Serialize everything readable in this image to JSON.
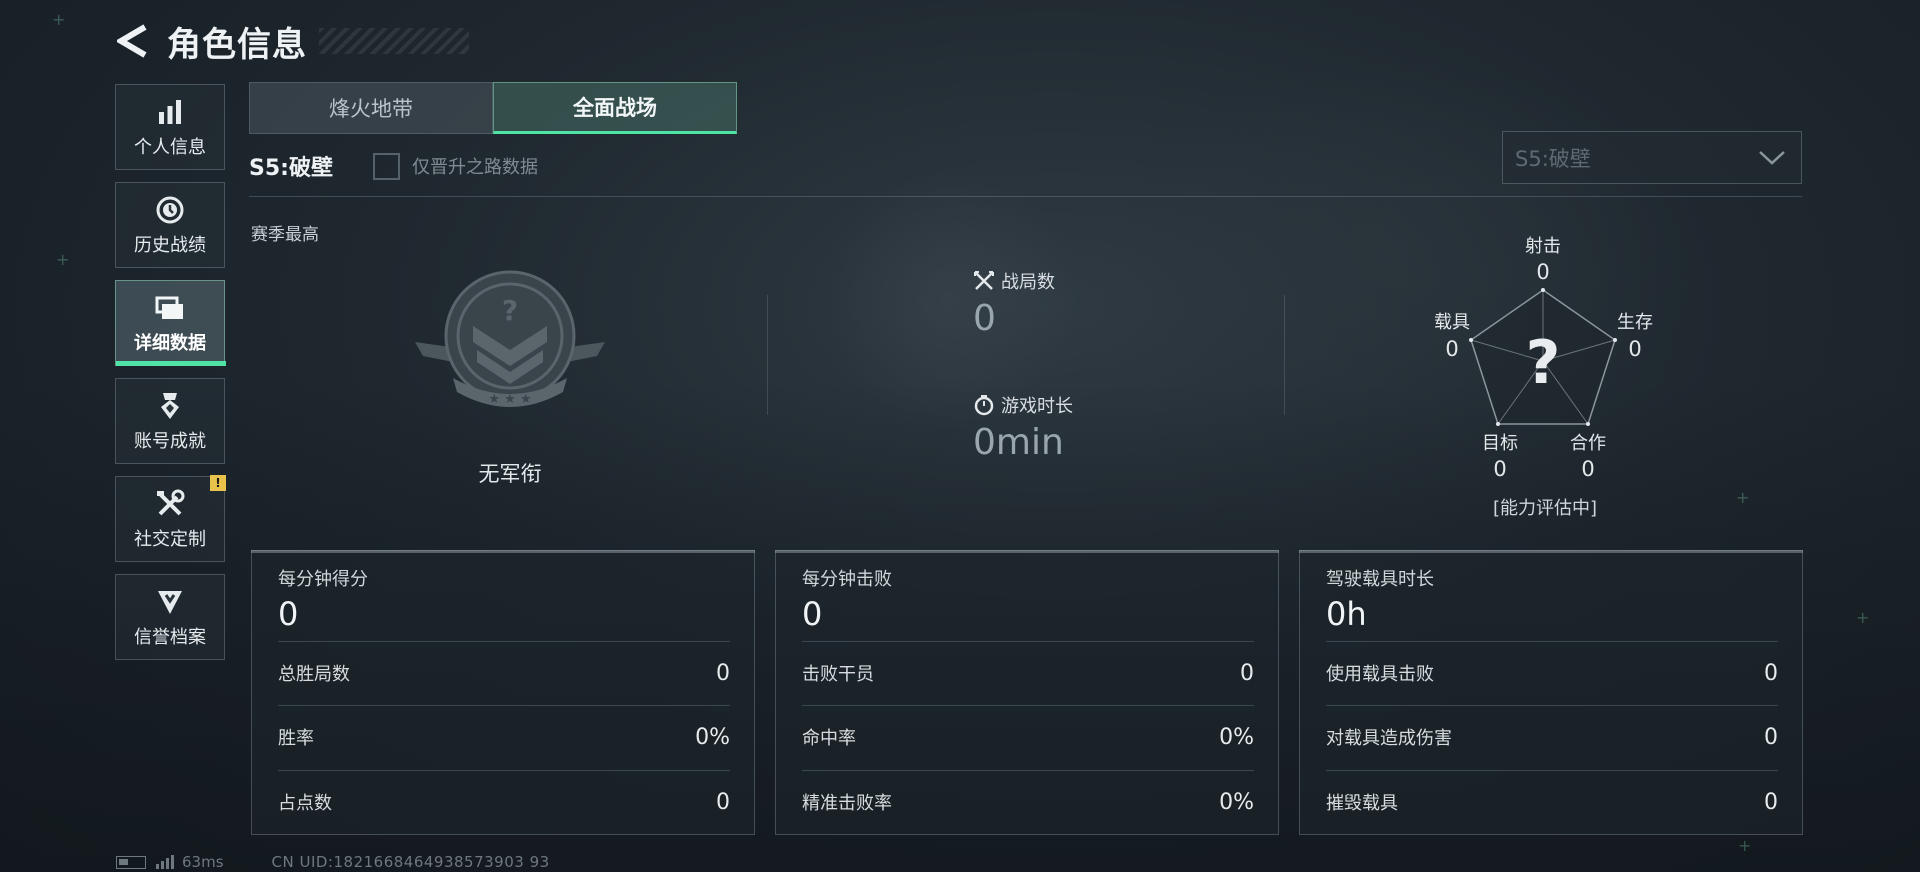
{
  "header": {
    "title": "角色信息"
  },
  "sidebar": {
    "items": [
      {
        "label": "个人信息",
        "icon": "bar-chart-icon",
        "active": false
      },
      {
        "label": "历史战绩",
        "icon": "history-icon",
        "active": false
      },
      {
        "label": "详细数据",
        "icon": "folder-icon",
        "active": true
      },
      {
        "label": "账号成就",
        "icon": "medal-icon",
        "active": false
      },
      {
        "label": "社交定制",
        "icon": "tools-icon",
        "active": false,
        "badge": "!"
      },
      {
        "label": "信誉档案",
        "icon": "shield-icon",
        "active": false
      }
    ]
  },
  "tabs": [
    {
      "label": "烽火地带",
      "active": false
    },
    {
      "label": "全面战场",
      "active": true
    }
  ],
  "season": {
    "label": "S5:破壁",
    "checkbox_label": "仅晋升之路数据",
    "checkbox_checked": false,
    "select_value": "S5:破壁"
  },
  "overview": {
    "section_label": "赛季最高",
    "rank_name": "无军衔",
    "matches_label": "战局数",
    "matches_value": "0",
    "playtime_label": "游戏时长",
    "playtime_value": "0min"
  },
  "radar": {
    "axes": [
      {
        "label": "射击",
        "value": "0"
      },
      {
        "label": "生存",
        "value": "0"
      },
      {
        "label": "合作",
        "value": "0"
      },
      {
        "label": "目标",
        "value": "0"
      },
      {
        "label": "载具",
        "value": "0"
      }
    ],
    "center_mark": "?",
    "status": "[能力评估中]"
  },
  "cards": [
    {
      "title": "每分钟得分",
      "value": "0",
      "rows": [
        {
          "label": "总胜局数",
          "value": "0"
        },
        {
          "label": "胜率",
          "value": "0%"
        },
        {
          "label": "占点数",
          "value": "0"
        }
      ]
    },
    {
      "title": "每分钟击败",
      "value": "0",
      "rows": [
        {
          "label": "击败干员",
          "value": "0"
        },
        {
          "label": "命中率",
          "value": "0%"
        },
        {
          "label": "精准击败率",
          "value": "0%"
        }
      ]
    },
    {
      "title": "驾驶载具时长",
      "value": "0h",
      "rows": [
        {
          "label": "使用载具击败",
          "value": "0"
        },
        {
          "label": "对载具造成伤害",
          "value": "0"
        },
        {
          "label": "摧毁载具",
          "value": "0"
        }
      ]
    }
  ],
  "footer": {
    "ping": "63ms",
    "uid": "CN UID:1821668464938573903 93"
  },
  "colors": {
    "accent": "#4fe3a6",
    "badge": "#e8c24a"
  }
}
